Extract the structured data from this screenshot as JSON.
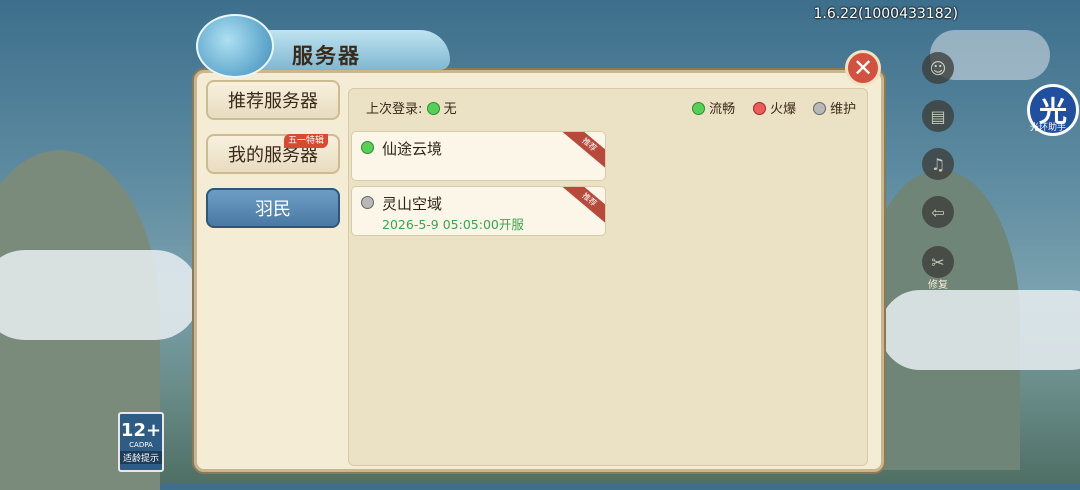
{
  "version": "1.6.22(1000433182)",
  "dialog": {
    "title": "服务器",
    "close_glyph": "✕"
  },
  "tabs": [
    {
      "label": "推荐服务器",
      "active": false
    },
    {
      "label": "我的服务器",
      "active": false,
      "badge": "五一特辑"
    },
    {
      "label": "羽民",
      "active": true
    }
  ],
  "last_login": {
    "label": "上次登录:",
    "value": "无",
    "status": "green"
  },
  "legend": [
    {
      "label": "流畅",
      "color": "#58d058"
    },
    {
      "label": "火爆",
      "color": "#ef5a5a"
    },
    {
      "label": "维护",
      "color": "#b8b8b8"
    }
  ],
  "servers": [
    {
      "name": "仙途云境",
      "status": "green",
      "tag": "推荐",
      "date": ""
    },
    {
      "name": "灵山空域",
      "status": "gray",
      "tag": "推荐",
      "date": "2026-5-9 05:05:00开服"
    }
  ],
  "side_menu": [
    {
      "icon": "service-icon",
      "glyph": "☺",
      "label": ""
    },
    {
      "icon": "notice-icon",
      "glyph": "▤",
      "label": ""
    },
    {
      "icon": "mute-icon",
      "glyph": "♫",
      "label": ""
    },
    {
      "icon": "exit-icon",
      "glyph": "⇦",
      "label": ""
    },
    {
      "icon": "repair-icon",
      "glyph": "✂",
      "label": "修复"
    }
  ],
  "helper": {
    "glyph": "光",
    "label": "光环助手"
  },
  "age_rating": {
    "number": "12+",
    "org": "CADPA",
    "text": "适龄提示"
  }
}
